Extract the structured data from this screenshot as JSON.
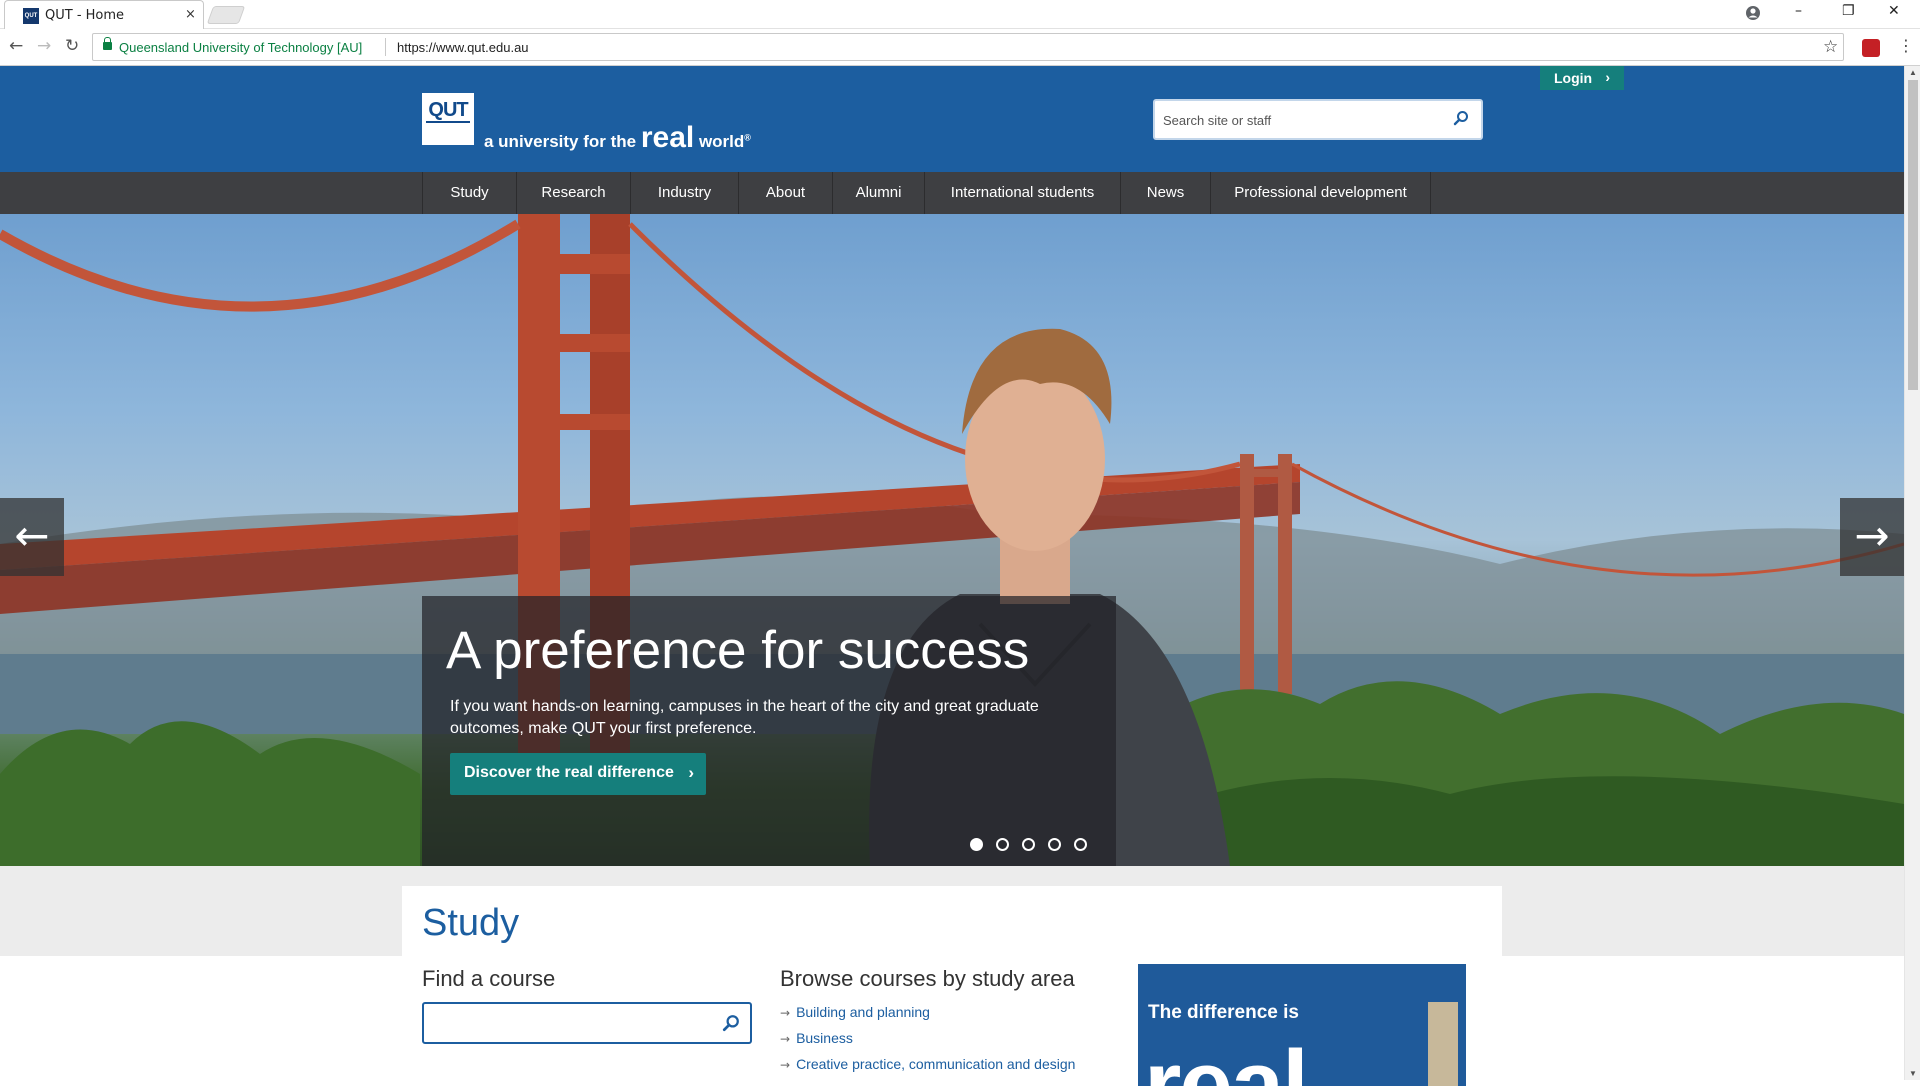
{
  "browser": {
    "tab_title": "QUT - Home",
    "tab_close": "×",
    "window_controls": {
      "minimize": "–",
      "restore": "❐",
      "close": "✕"
    },
    "back": "←",
    "forward": "→",
    "reload": "↻",
    "site_identity": "Queensland University of Technology [AU]",
    "url": "https://www.qut.edu.au",
    "bookmark_star": "☆",
    "menu": "⋮"
  },
  "header": {
    "logo_text": "QUT",
    "tagline_prefix": "a university for the ",
    "tagline_real": "real",
    "tagline_world": " world",
    "tagline_reg": "®",
    "login_label": "Login",
    "login_chevron": "›",
    "search_placeholder": "Search site or staff"
  },
  "nav": {
    "items": [
      {
        "label": "Study"
      },
      {
        "label": "Research"
      },
      {
        "label": "Industry"
      },
      {
        "label": "About"
      },
      {
        "label": "Alumni"
      },
      {
        "label": "International students"
      },
      {
        "label": "News"
      },
      {
        "label": "Professional development"
      }
    ]
  },
  "hero": {
    "title": "A preference for success",
    "text": "If you want hands-on learning, campuses in the heart of the city and great graduate outcomes, make QUT your first preference.",
    "cta_label": "Discover the real difference",
    "cta_chevron": "›",
    "prev_arrow": "←",
    "next_arrow": "→",
    "slide_count": 5,
    "active_slide": 1
  },
  "study": {
    "title": "Study",
    "find_title": "Find a course",
    "find_value": "",
    "browse_title": "Browse courses by study area",
    "link_arrow": "→",
    "areas": [
      "Building and planning",
      "Business",
      "Creative practice, communication and design"
    ],
    "promo_text": "The difference is",
    "promo_big": "real"
  },
  "colors": {
    "brand_blue": "#1c5ea0",
    "nav_dark": "#3e3f42",
    "teal_button": "#157f7c"
  }
}
